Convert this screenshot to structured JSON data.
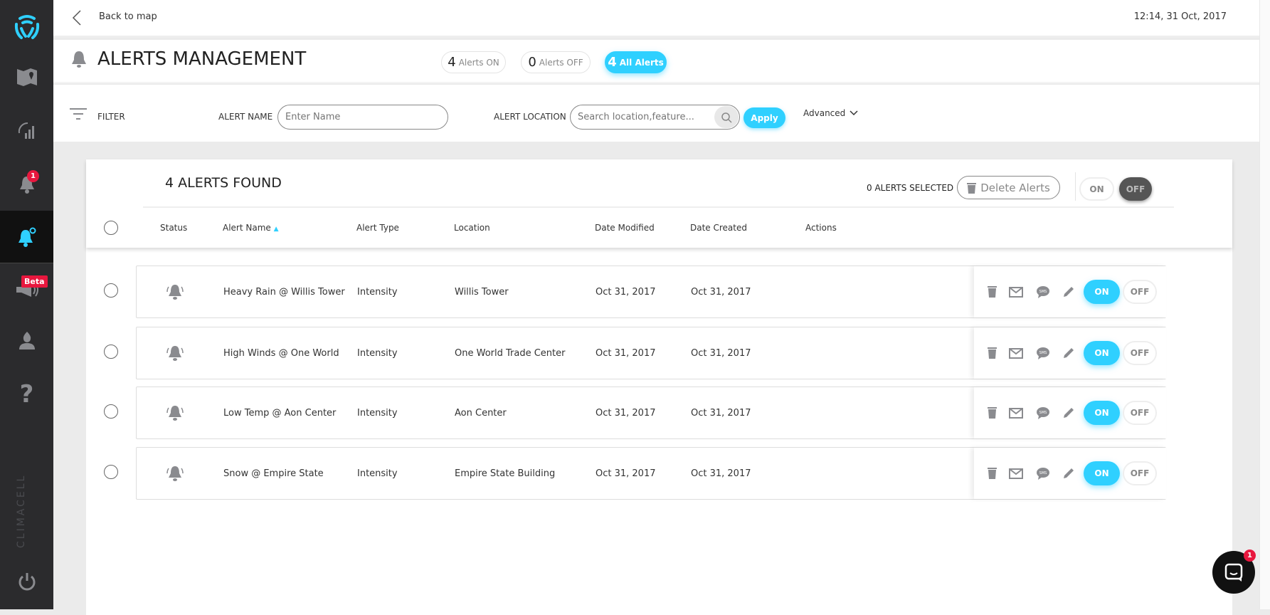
{
  "brand": {
    "name": "CLIMACELL",
    "accent": "#2fd0ff",
    "sidebar_bg": "#2b2b2d"
  },
  "sidebar": {
    "items": [
      {
        "icon": "map-icon"
      },
      {
        "icon": "signal-icon"
      },
      {
        "icon": "bell-icon",
        "badge": "1"
      },
      {
        "icon": "alert-settings-icon",
        "active": true
      },
      {
        "icon": "megaphone-icon",
        "badge": "Beta"
      },
      {
        "icon": "user-icon"
      },
      {
        "icon": "help-icon"
      }
    ],
    "logout_icon": "power-icon"
  },
  "topbar": {
    "back_label": "Back to map",
    "datetime": "12:14, 31 Oct, 2017"
  },
  "title": "ALERTS MANAGEMENT",
  "pills": [
    {
      "count": "4",
      "label": "Alerts ON"
    },
    {
      "count": "0",
      "label": "Alerts OFF"
    },
    {
      "count": "4",
      "label": "All Alerts",
      "selected": true
    }
  ],
  "filter": {
    "label": "FILTER",
    "name_label": "ALERT NAME",
    "name_placeholder": "Enter Name",
    "location_label": "ALERT LOCATION",
    "location_placeholder": "Search location,feature...",
    "apply": "Apply",
    "advanced": "Advanced"
  },
  "results": {
    "found": "4 ALERTS FOUND",
    "selected": "0 ALERTS SELECTED",
    "delete": "Delete Alerts",
    "on": "ON",
    "off": "OFF"
  },
  "columns": [
    "Status",
    "Alert Name",
    "Alert Type",
    "Location",
    "Date Modified",
    "Date Created",
    "Actions"
  ],
  "rows": [
    {
      "name": "Heavy Rain @ Willis Tower",
      "type": "Intensity",
      "location": "Willis Tower",
      "modified": "Oct 31, 2017",
      "created": "Oct 31, 2017",
      "state": "ON"
    },
    {
      "name": "High Winds @ One World",
      "type": "Intensity",
      "location": "One World Trade Center",
      "modified": "Oct 31, 2017",
      "created": "Oct 31, 2017",
      "state": "ON"
    },
    {
      "name": "Low Temp @ Aon Center",
      "type": "Intensity",
      "location": "Aon Center",
      "modified": "Oct 31, 2017",
      "created": "Oct 31, 2017",
      "state": "ON"
    },
    {
      "name": "Snow @ Empire State",
      "type": "Intensity",
      "location": "Empire State Building",
      "modified": "Oct 31, 2017",
      "created": "Oct 31, 2017",
      "state": "ON"
    }
  ],
  "row_labels": {
    "on": "ON",
    "off": "OFF",
    "sms": "SMS"
  },
  "chat": {
    "badge": "1"
  }
}
